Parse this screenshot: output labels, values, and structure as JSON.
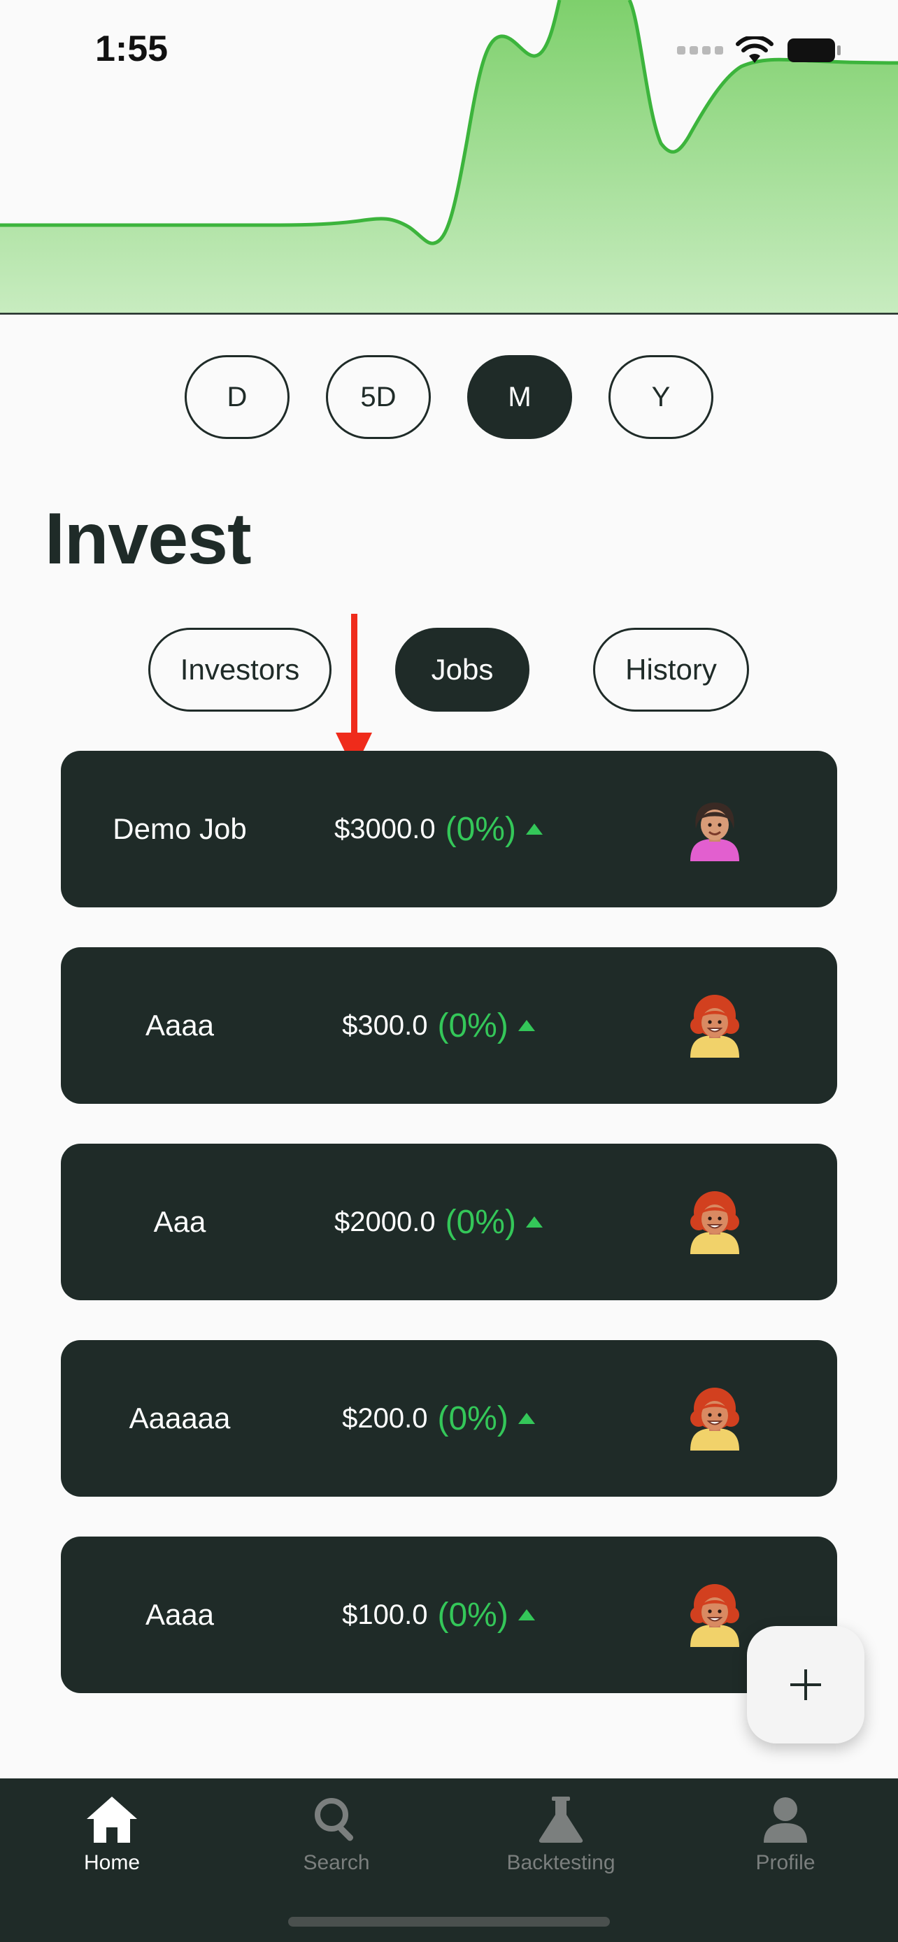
{
  "status_bar": {
    "time": "1:55"
  },
  "chart": {
    "type": "area",
    "line_color": "#3cb43c",
    "fill_color": "#a8e49a"
  },
  "ranges": [
    {
      "label": "D",
      "active": false
    },
    {
      "label": "5D",
      "active": false
    },
    {
      "label": "M",
      "active": true
    },
    {
      "label": "Y",
      "active": false
    }
  ],
  "page_title": "Invest",
  "tabs": [
    {
      "label": "Investors",
      "active": false
    },
    {
      "label": "Jobs",
      "active": true
    },
    {
      "label": "History",
      "active": false
    }
  ],
  "jobs": [
    {
      "name": "Demo Job",
      "amount": "$3000.0",
      "change": "(0%)",
      "avatar": "woman-dark-hair-avatar"
    },
    {
      "name": "Aaaa",
      "amount": "$300.0",
      "change": "(0%)",
      "avatar": "woman-red-hair-avatar"
    },
    {
      "name": "Aaa",
      "amount": "$2000.0",
      "change": "(0%)",
      "avatar": "woman-red-hair-avatar"
    },
    {
      "name": "Aaaaaa",
      "amount": "$200.0",
      "change": "(0%)",
      "avatar": "woman-red-hair-avatar"
    },
    {
      "name": "Aaaa",
      "amount": "$100.0",
      "change": "(0%)",
      "avatar": "woman-red-hair-avatar"
    }
  ],
  "fab": {
    "icon": "plus-icon"
  },
  "nav": [
    {
      "label": "Home",
      "icon": "home-icon",
      "active": true
    },
    {
      "label": "Search",
      "icon": "search-icon",
      "active": false
    },
    {
      "label": "Backtesting",
      "icon": "flask-icon",
      "active": false
    },
    {
      "label": "Profile",
      "icon": "person-icon",
      "active": false
    }
  ],
  "colors": {
    "dark": "#1f2b28",
    "accent": "#34c759",
    "background": "#fafafa"
  }
}
